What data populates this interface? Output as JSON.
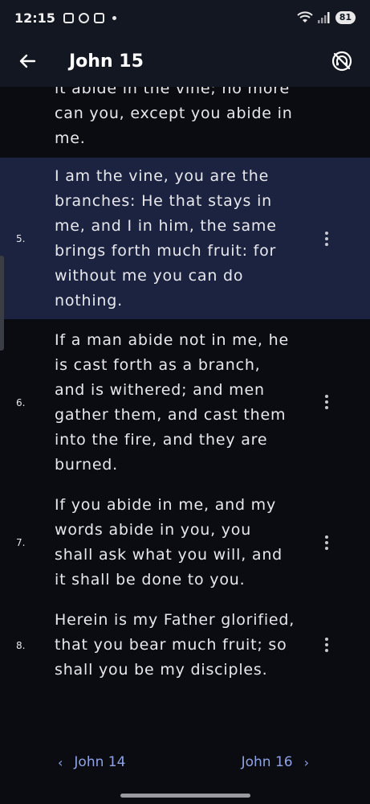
{
  "status_bar": {
    "time": "12:15",
    "battery": "81"
  },
  "app_bar": {
    "title": "John 15"
  },
  "verses": [
    {
      "number": "",
      "text": "it abide in the vine; no more can you, except you abide in me.",
      "highlighted": false
    },
    {
      "number": "5.",
      "text": "I am the vine, you are the branches: He that stays in me, and I in him, the same brings forth much fruit: for without me you can do nothing.",
      "highlighted": true
    },
    {
      "number": "6.",
      "text": "If a man abide not in me, he is cast forth as a branch, and is withered; and men gather them, and cast them into the fire, and they are burned.",
      "highlighted": false
    },
    {
      "number": "7.",
      "text": "If you abide in me, and my words abide in you, you shall ask what you will, and it shall be done to you.",
      "highlighted": false
    },
    {
      "number": "8.",
      "text": "Herein is my Father glorified, that you bear much fruit; so shall you be my disciples.",
      "highlighted": false
    }
  ],
  "chapter_nav": {
    "prev_label": "John 14",
    "next_label": "John 16"
  },
  "colors": {
    "background": "#0a0c12",
    "app_bar": "#131722",
    "highlight": "#1b2340",
    "accent": "#8fa2e6"
  }
}
